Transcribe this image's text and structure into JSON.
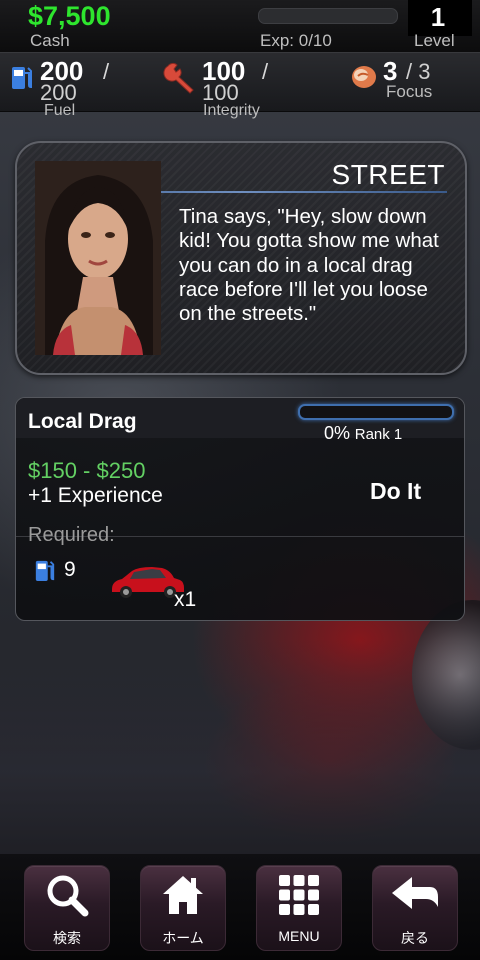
{
  "header": {
    "cash_value": "$7,500",
    "cash_label": "Cash",
    "exp_label": "Exp: 0/10",
    "exp_progress": 0,
    "level_value": "1",
    "level_label": "Level"
  },
  "stats": {
    "fuel": {
      "current": "200",
      "slash": "/",
      "max": "200",
      "label": "Fuel",
      "icon": "fuel-pump-icon"
    },
    "integrity": {
      "current": "100",
      "slash": "/",
      "max": "100",
      "label": "Integrity",
      "icon": "wrench-icon"
    },
    "focus": {
      "current": "3",
      "slash_max": "/ 3",
      "label": "Focus",
      "icon": "focus-icon"
    }
  },
  "story": {
    "title": "STREET",
    "text": "Tina says, \"Hey, slow down kid! You gotta show me what you can do in a local drag race before I'll let you loose on the streets.\""
  },
  "mission": {
    "name": "Local Drag",
    "progress_percent": 0,
    "progress_text": "0%",
    "rank_text": "Rank 1",
    "reward": "$150 - $250",
    "experience": "+1 Experience",
    "action_label": "Do It",
    "required_label": "Required:",
    "required_fuel": "9",
    "required_car_count": "x1"
  },
  "nav": {
    "items": [
      {
        "label": "検索",
        "icon": "search-icon"
      },
      {
        "label": "ホーム",
        "icon": "home-icon"
      },
      {
        "label": "MENU",
        "icon": "grid-menu-icon"
      },
      {
        "label": "戻る",
        "icon": "back-arrow-icon"
      }
    ]
  },
  "colors": {
    "cash_green": "#2ee52e",
    "reward_green": "#63d063",
    "progress_blue": "#3f6fae"
  }
}
